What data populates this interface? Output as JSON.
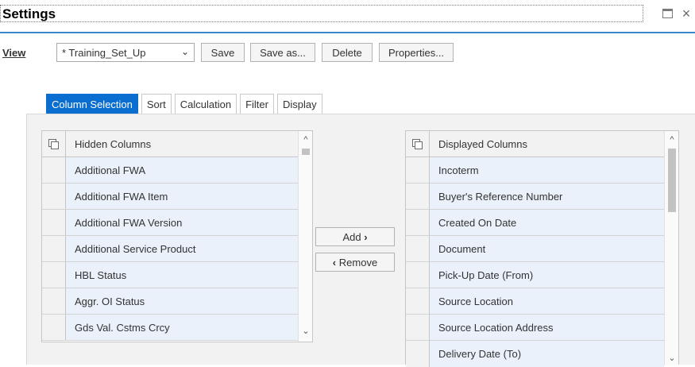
{
  "dialog": {
    "title": "Settings"
  },
  "toolbar": {
    "view_label": "View",
    "view_select_value": "* Training_Set_Up",
    "save_label": "Save",
    "save_as_label": "Save as...",
    "delete_label": "Delete",
    "properties_label": "Properties..."
  },
  "tabs": [
    {
      "label": "Column Selection",
      "active": true
    },
    {
      "label": "Sort",
      "active": false
    },
    {
      "label": "Calculation",
      "active": false
    },
    {
      "label": "Filter",
      "active": false
    },
    {
      "label": "Display",
      "active": false
    }
  ],
  "hidden_columns": {
    "header": "Hidden Columns",
    "rows": [
      "Additional FWA",
      "Additional FWA Item",
      "Additional FWA Version",
      "Additional Service Product",
      "HBL Status",
      "Aggr. OI Status",
      "Gds Val. Cstms Crcy"
    ]
  },
  "displayed_columns": {
    "header": "Displayed Columns",
    "rows": [
      "Incoterm",
      "Buyer's Reference Number",
      "Created On Date",
      "Document",
      "Pick-Up Date (From)",
      "Source Location",
      "Source Location Address",
      "Delivery Date (To)"
    ]
  },
  "actions": {
    "add_label": "Add",
    "add_arrow": "›",
    "remove_label": "Remove",
    "remove_arrow": "‹"
  },
  "icons": {
    "maximize": "maximize-icon",
    "close": "×",
    "chevron_down": "⌄",
    "scroll_up": "^",
    "scroll_down": "⌄"
  },
  "colors": {
    "accent": "#0a6ed1",
    "title_underline": "#3b86c6",
    "row_background": "#eaf1fb"
  }
}
